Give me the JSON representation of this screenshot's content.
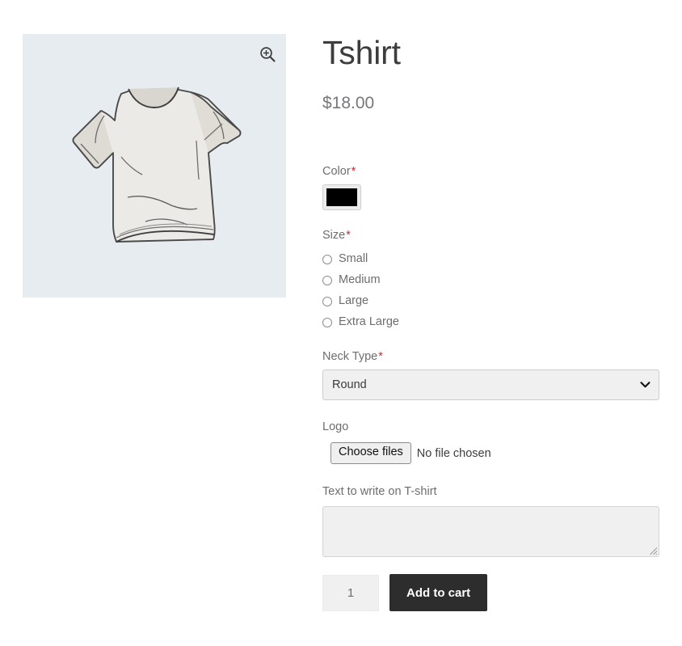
{
  "product": {
    "title": "Tshirt",
    "price": "$18.00",
    "image_alt": "tshirt-sketch-illustration",
    "image_bg_color": "#e7ecf0",
    "zoom_icon": "zoom-in-icon"
  },
  "form": {
    "required_marker": "*",
    "color": {
      "label": "Color",
      "required": true,
      "value": "#000000"
    },
    "size": {
      "label": "Size",
      "required": true,
      "selected": null,
      "options": [
        {
          "label": "Small",
          "checked": false
        },
        {
          "label": "Medium",
          "checked": false
        },
        {
          "label": "Large",
          "checked": false
        },
        {
          "label": "Extra Large",
          "checked": false
        }
      ]
    },
    "neck_type": {
      "label": "Neck Type",
      "required": true,
      "value": "Round",
      "icon": "chevron-down-icon"
    },
    "logo": {
      "label": "Logo",
      "required": false,
      "button_label": "Choose files",
      "status": "No file chosen"
    },
    "custom_text": {
      "label": "Text to write on T-shirt",
      "required": false,
      "value": "",
      "placeholder": ""
    }
  },
  "cart": {
    "quantity": "1",
    "add_to_cart_label": "Add to cart",
    "button_color": "#2d2d2d"
  },
  "colors": {
    "required_asterisk": "#cc2936",
    "label_text": "#6d6d6d",
    "title_text": "#3d3d3d",
    "price_text": "#77777b",
    "field_bg": "#f0f0f0"
  }
}
